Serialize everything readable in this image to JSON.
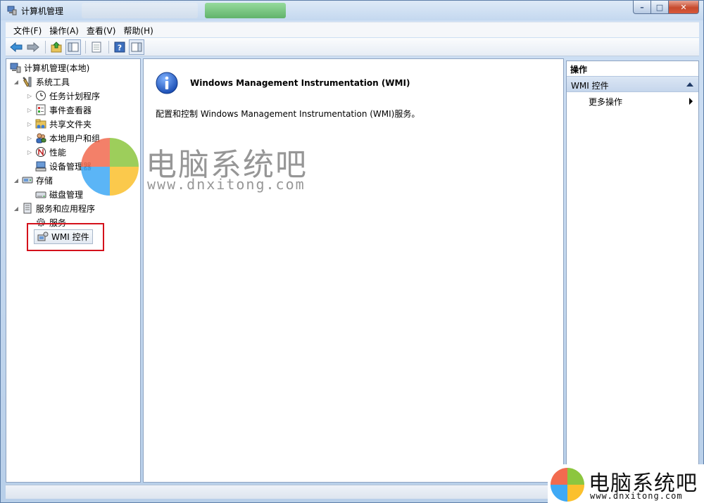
{
  "window": {
    "title": "计算机管理",
    "minimize_glyph": "–",
    "maximize_glyph": "□",
    "close_glyph": "✕"
  },
  "menu": {
    "items": [
      "文件(F)",
      "操作(A)",
      "查看(V)",
      "帮助(H)"
    ]
  },
  "toolbar": {
    "icons": [
      "back-arrow-icon",
      "forward-arrow-icon",
      "up-folder-icon",
      "show-hide-tree-icon",
      "export-list-icon",
      "help-icon",
      "show-hide-action-pane-icon"
    ]
  },
  "tree": {
    "root": "计算机管理(本地)",
    "system_tools": "系统工具",
    "task_scheduler": "任务计划程序",
    "event_viewer": "事件查看器",
    "shared_folders": "共享文件夹",
    "local_users": "本地用户和组",
    "performance": "性能",
    "device_manager": "设备管理器",
    "storage": "存储",
    "disk_management": "磁盘管理",
    "services_apps": "服务和应用程序",
    "services": "服务",
    "wmi_control": "WMI 控件"
  },
  "center": {
    "title": "Windows Management Instrumentation (WMI)",
    "description": "配置和控制 Windows Management Instrumentation (WMI)服务。"
  },
  "actions": {
    "header": "操作",
    "section": "WMI 控件",
    "more": "更多操作"
  },
  "watermark": {
    "name": "电脑系统吧",
    "url": "www.dnxitong.com"
  },
  "colors": {
    "highlight_frame": "#d4111b",
    "logo_red": "#f26b4f",
    "logo_green": "#8cc63f",
    "logo_blue": "#3fa9f5",
    "logo_yellow": "#fbc02d"
  }
}
